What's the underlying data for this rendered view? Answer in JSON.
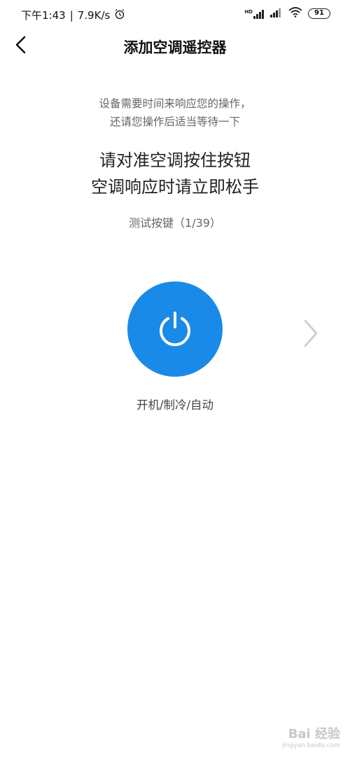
{
  "status_bar": {
    "time": "下午1:43",
    "speed": "7.9K/s",
    "signal_label": "HD",
    "battery": "91"
  },
  "header": {
    "title": "添加空调遥控器"
  },
  "main": {
    "hint_line1": "设备需要时间来响应您的操作，",
    "hint_line2": "还请您操作后适当等待一下",
    "instruction_line1": "请对准空调按住按钮",
    "instruction_line2": "空调响应时请立即松手",
    "counter": "测试按键（1/39）",
    "button_label": "开机/制冷/自动"
  },
  "watermark": {
    "logo": "Bai 经验",
    "url": "jingyan.baidu.com"
  },
  "colors": {
    "accent": "#1a8ae8"
  }
}
